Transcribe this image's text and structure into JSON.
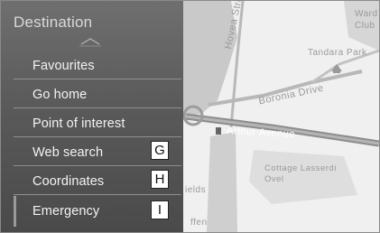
{
  "panel": {
    "title": "Destination",
    "items": [
      {
        "label": "Favourites"
      },
      {
        "label": "Go home"
      },
      {
        "label": "Point of interest"
      },
      {
        "label": "Web search",
        "callout": "G"
      },
      {
        "label": "Coordinates",
        "callout": "H"
      },
      {
        "label": "Emergency",
        "callout": "I"
      }
    ]
  },
  "map": {
    "labels": {
      "hovea_street": "Hovea Street",
      "boronia_drive": "Boronia Drive",
      "arthur_avenue": "Arthur Avenue",
      "tandara_park": "Tandara Park",
      "ward_club": "Ward Club",
      "cottage_lasserdi_ovel": "Cottage Lasserdi Ovel",
      "fields_fragment": "ields",
      "bottom_fragment": "ffen"
    }
  }
}
